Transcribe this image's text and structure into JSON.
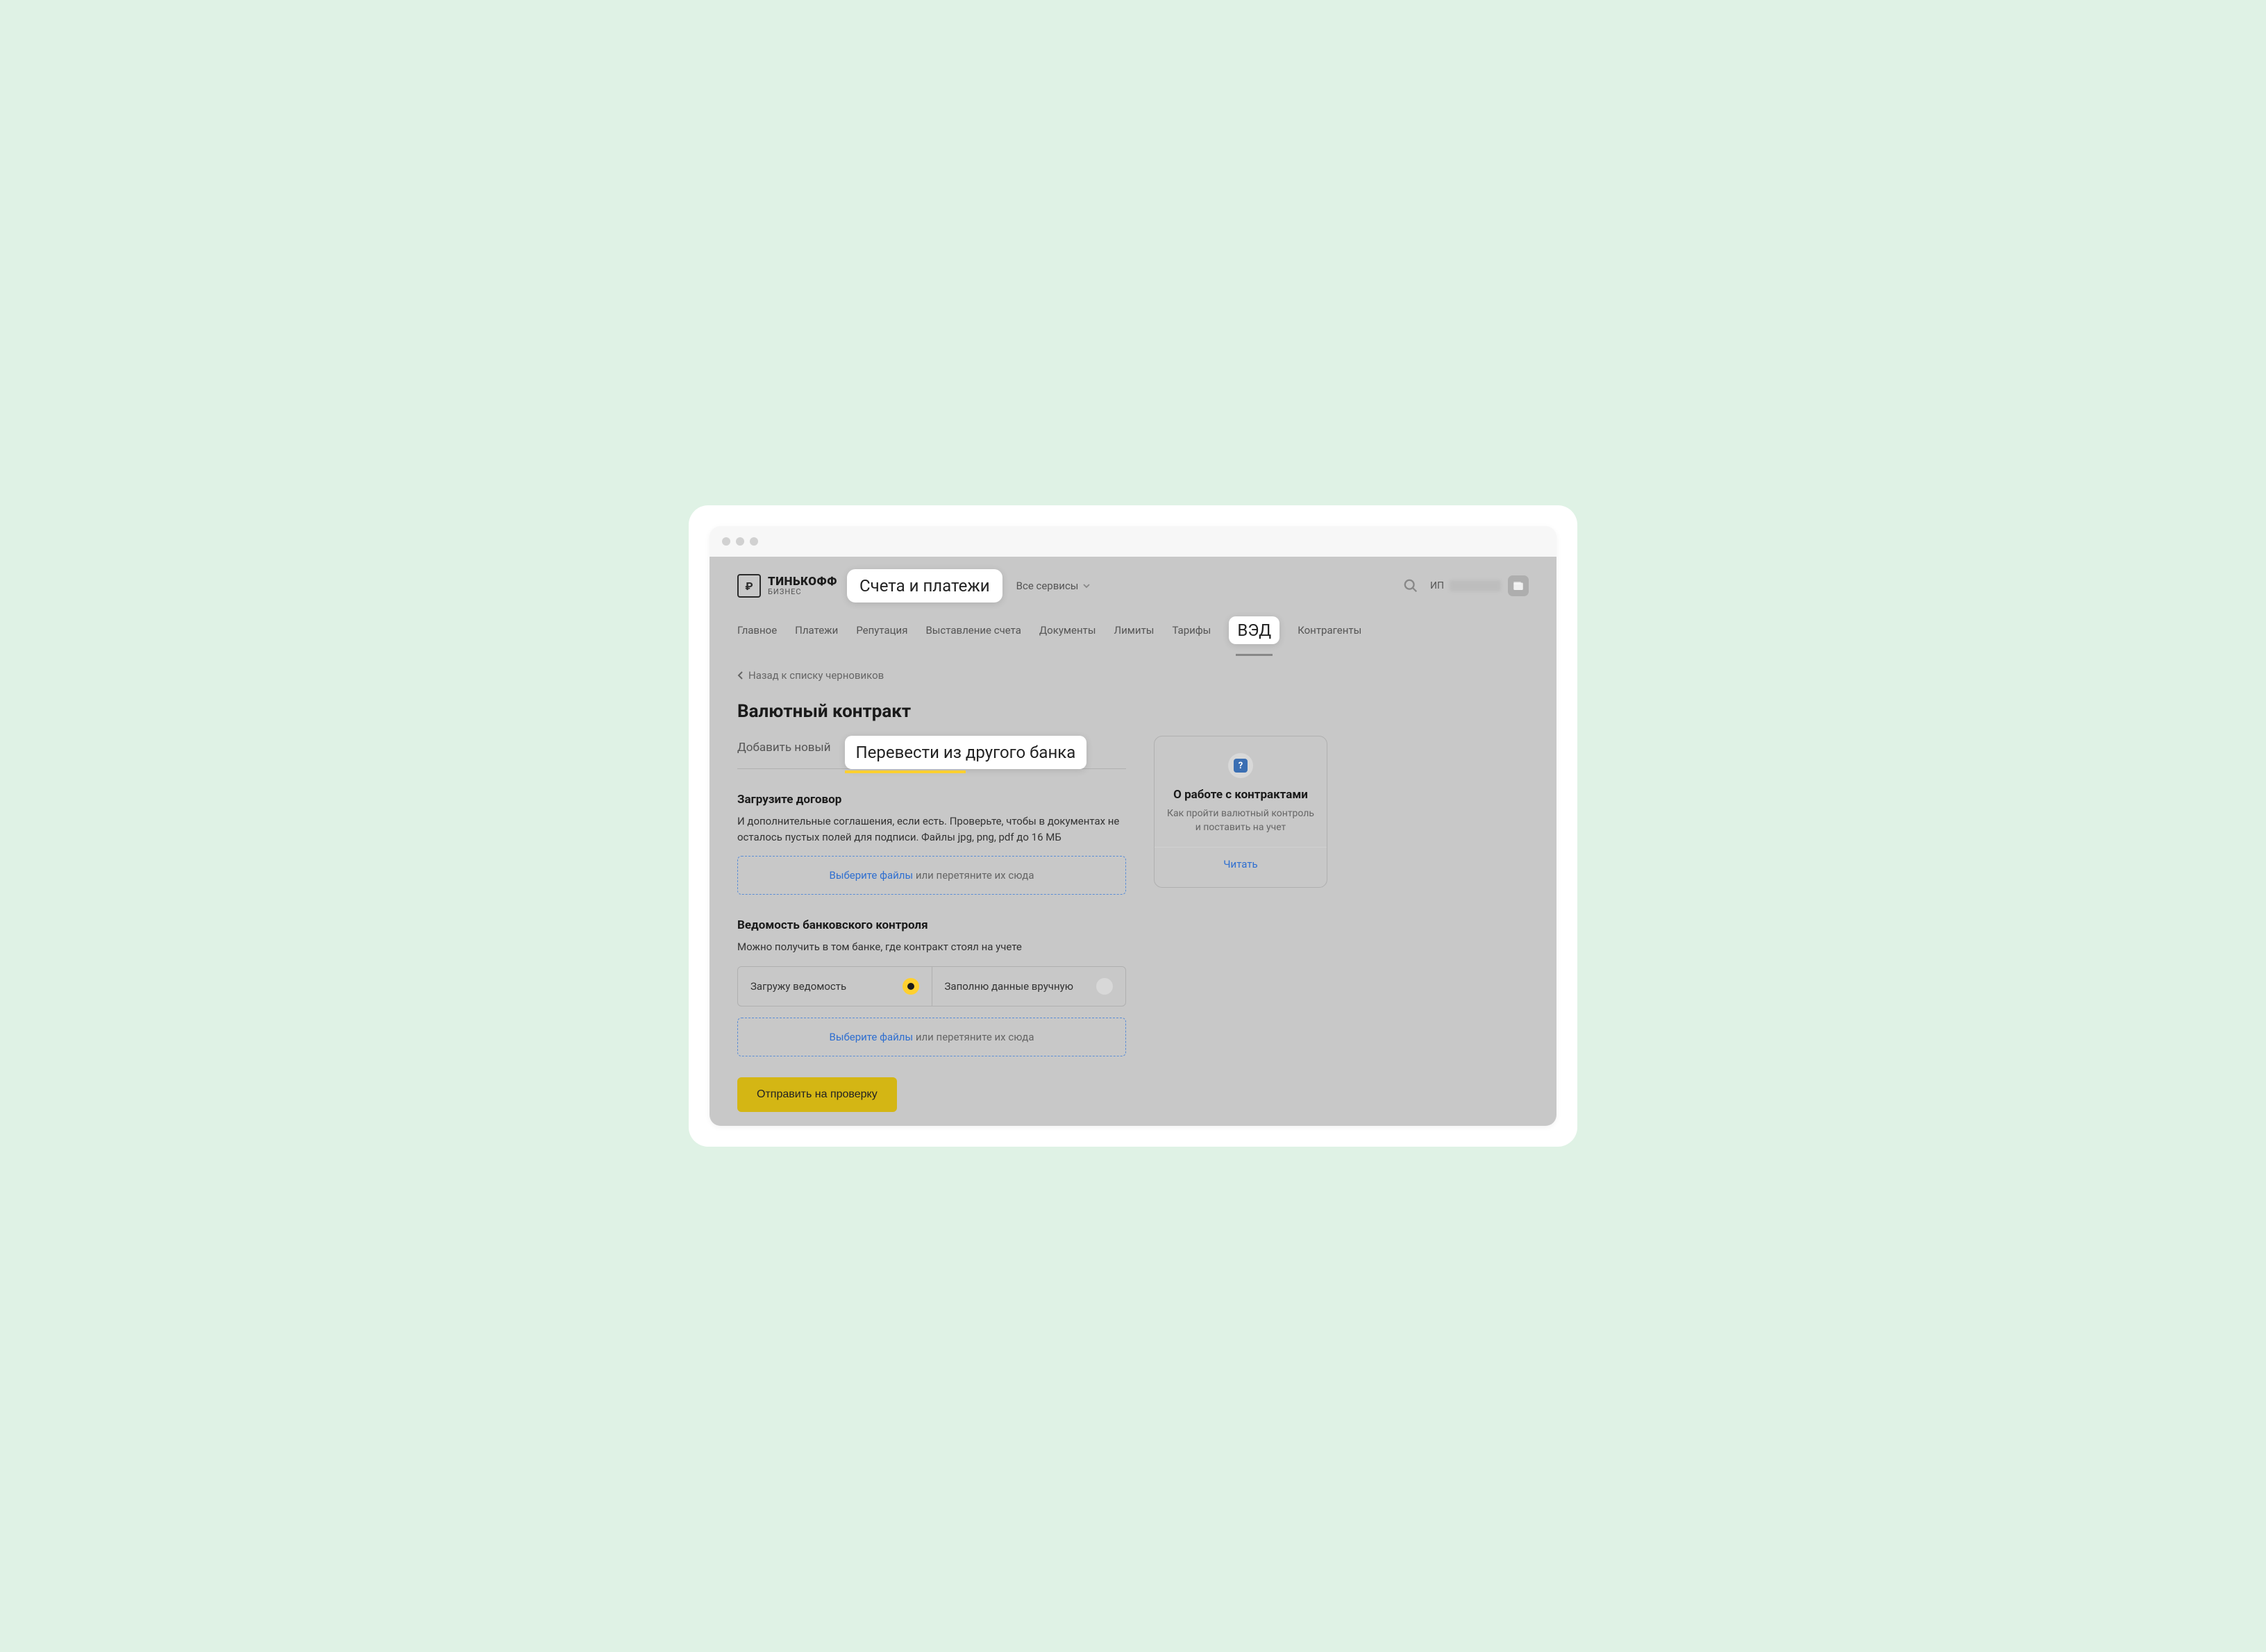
{
  "logo": {
    "main": "ТИНЬКОФФ",
    "sub": "БИЗНЕС"
  },
  "topbar": {
    "section_highlight": "Счета и платежи",
    "all_services": "Все сервисы",
    "user_prefix": "ИП"
  },
  "nav": {
    "items": [
      "Главное",
      "Платежи",
      "Репутация",
      "Выставление счета",
      "Документы",
      "Лимиты",
      "Тарифы"
    ],
    "highlight": "ВЭД",
    "after": [
      "Контрагенты"
    ]
  },
  "back_link": "Назад к списку черновиков",
  "page_title": "Валютный контракт",
  "tabs": {
    "plain": "Добавить новый",
    "highlight": "Перевести из другого банка"
  },
  "upload1": {
    "title": "Загрузите договор",
    "desc": "И дополнительные соглашения, если есть. Проверьте, чтобы в документах не осталось пустых полей для подписи. Файлы jpg, png, pdf до 16 МБ",
    "link": "Выберите файлы",
    "rest": " или перетяните их сюда"
  },
  "upload2": {
    "title": "Ведомость банковского контроля",
    "desc": "Можно получить в том банке, где контракт стоял на учете",
    "opt1": "Загружу ведомость",
    "opt2": "Заполню данные вручную",
    "link": "Выберите файлы",
    "rest": " или перетяните их сюда"
  },
  "submit": "Отправить на проверку",
  "info": {
    "title": "О работе с контрактами",
    "sub": "Как пройти валютный контроль и поставить на учет",
    "link": "Читать"
  }
}
